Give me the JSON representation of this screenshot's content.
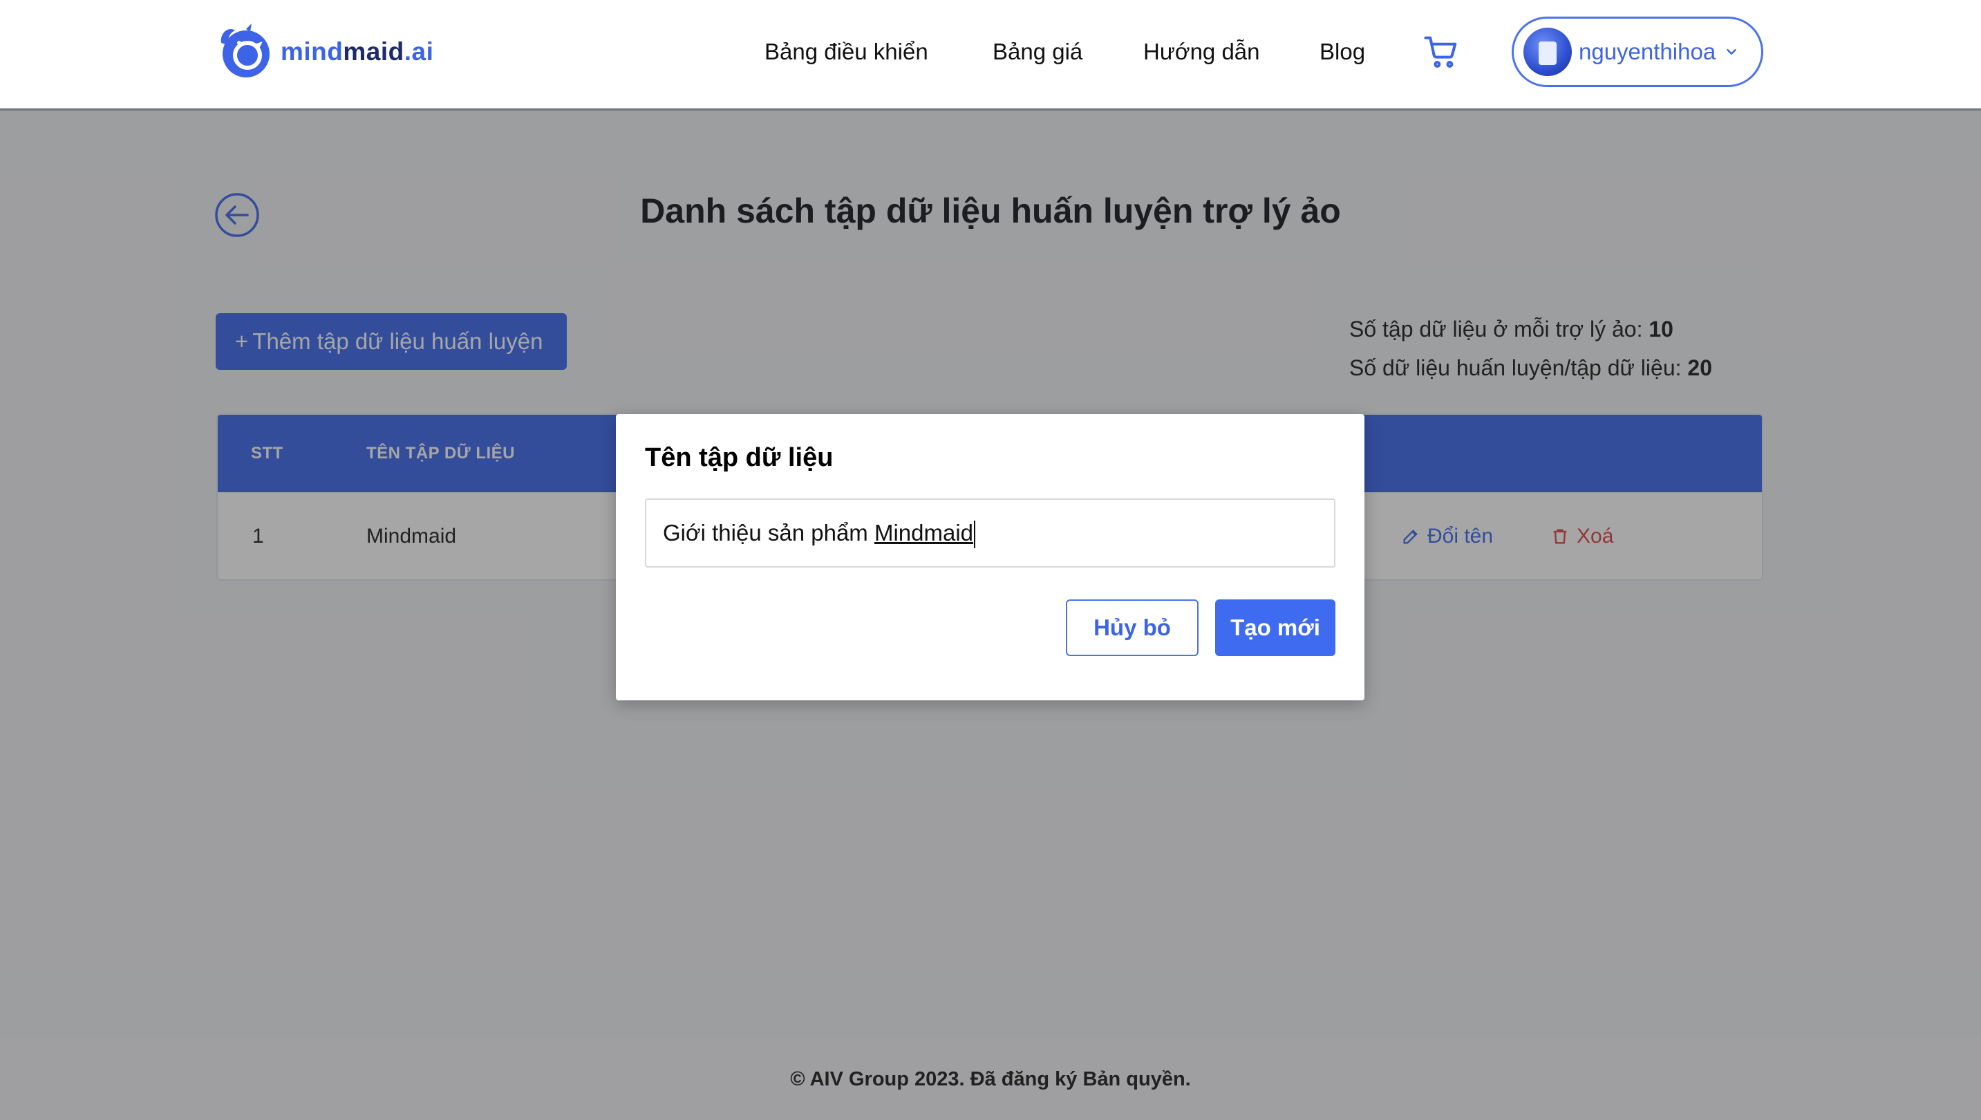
{
  "brand": {
    "part1": "mind",
    "part2": "maid",
    "part3": ".ai"
  },
  "nav": {
    "items": [
      {
        "label": "Bảng điều khiển"
      },
      {
        "label": "Bảng giá"
      },
      {
        "label": "Hướng dẫn"
      },
      {
        "label": "Blog"
      }
    ],
    "cart_icon": "cart-icon"
  },
  "user": {
    "name": "nguyenthihoa"
  },
  "page": {
    "title": "Danh sách tập dữ liệu huấn luyện trợ lý ảo",
    "add_button": "Thêm tập dữ liệu huấn luyện",
    "limits": {
      "per_assistant_label": "Số tập dữ liệu ở mỗi trợ lý ảo:",
      "per_assistant_value": "10",
      "per_dataset_label": "Số dữ liệu huấn luyện/tập dữ liệu:",
      "per_dataset_value": "20"
    }
  },
  "table": {
    "columns": [
      "STT",
      "TÊN TẬP DỮ LIỆU"
    ],
    "rows": [
      {
        "index": "1",
        "name": "Mindmaid",
        "rename": "Đổi tên",
        "delete": "Xoá"
      }
    ]
  },
  "modal": {
    "title": "Tên tập dữ liệu",
    "input_prefix": "Giới thiệu sản phẩm ",
    "input_underlined": "Mindmaid",
    "cancel": "Hủy bỏ",
    "create": "Tạo mới"
  },
  "footer": {
    "text": "© AIV Group 2023. Đã đăng ký Bản quyền."
  },
  "colors": {
    "accent": "#4f77ee",
    "brand_dark": "#1e2b6b",
    "danger": "#e25555"
  }
}
